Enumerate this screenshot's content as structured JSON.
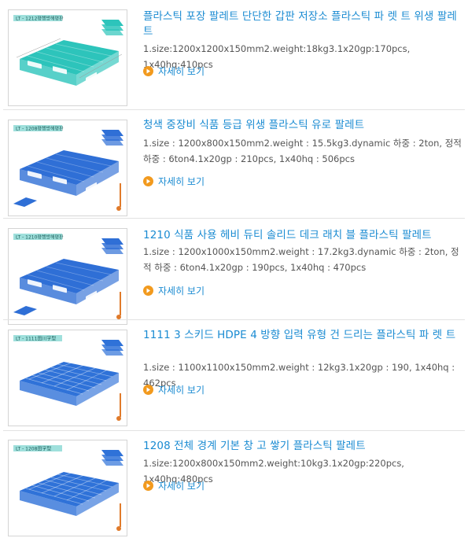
{
  "colors": {
    "title": "#1a8bd2",
    "text": "#555555",
    "arrow": "#f29a1e",
    "separator": "#e2e2e2"
  },
  "items": [
    {
      "model_tag": "LT - 1212평행방해평판",
      "pallet_color": "#2dc4bb",
      "title": "플라스틱 포장 팔레트 단단한 갑판 저장소 플라스틱 파 렛 트 위생 팔레트",
      "desc": "1.size:1200x1200x150mm2.weight:18kg3.1x20gp:170pcs, 1x40hq:410pcs",
      "more_label": "자세히 보기"
    },
    {
      "model_tag": "LT - 1208평행방해평판",
      "pallet_color": "#2f6fd6",
      "title": "청색 중장비 식품 등급 위생 플라스틱 유로 팔레트",
      "desc": "1.size : 1200x800x150mm2.weight : 15.5kg3.dynamic 하중 : 2ton, 정적 하중 : 6ton4.1x20gp : 210pcs, 1x40hq : 506pcs",
      "more_label": "자세히 보기"
    },
    {
      "model_tag": "LT - 1210평행방해평판",
      "pallet_color": "#2f6fd6",
      "title": "1210 식품 사용 헤비 듀티 솔리드 데크 래치 블 플라스틱 팔레트",
      "desc": "1.size : 1200x1000x150mm2.weight : 17.2kg3.dynamic 하중 : 2ton, 정적 하중 : 6ton4.1x20gp : 190pcs, 1x40hq : 470pcs",
      "more_label": "자세히 보기"
    },
    {
      "model_tag": "LT - 1111田川字型",
      "pallet_color": "#2f72d8",
      "title": "1111 3 스키드 HDPE 4 방향 입력 유형 건 드리는 플라스틱 파 렛 트",
      "desc": "1.size : 1100x1100x150mm2.weight : 12kg3.1x20gp : 190, 1x40hq : 462pcs",
      "more_label": "자세히 보기"
    },
    {
      "model_tag": "LT - 1208田字型",
      "pallet_color": "#2f72d8",
      "title": "1208 전체 경계 기본 창 고 쌓기 플라스틱 팔레트",
      "desc": "1.size:1200x800x150mm2.weight:10kg3.1x20gp:220pcs, 1x40hq:480pcs",
      "more_label": "자세히 보기"
    }
  ]
}
